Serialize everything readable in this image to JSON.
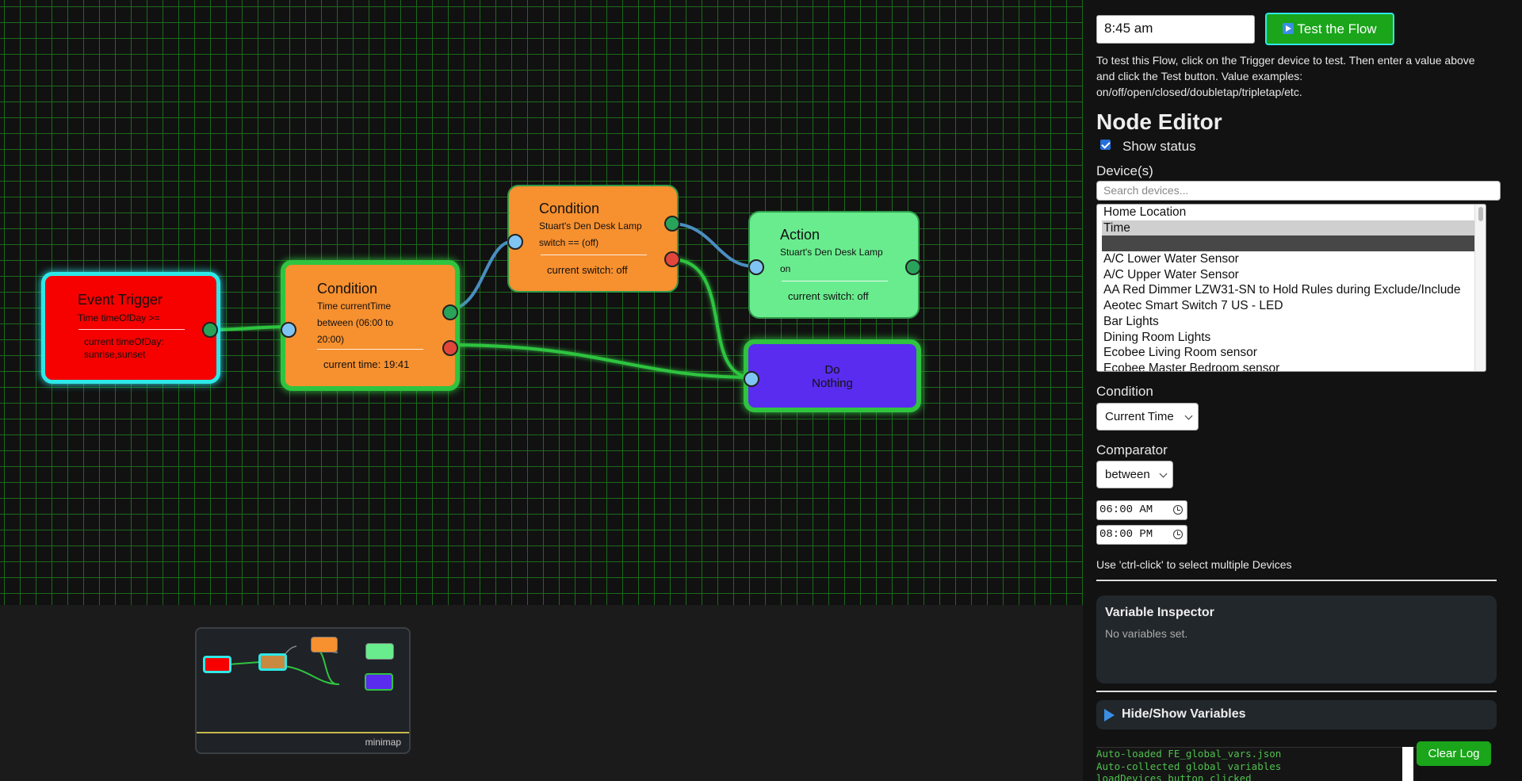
{
  "nodes": {
    "trigger": {
      "title": "Event Trigger",
      "subtitle": "Time timeOfDay >=",
      "status_1": "current timeOfDay:",
      "status_2": "sunrise,sunset"
    },
    "condition1": {
      "title": "Condition",
      "sub_1": "Time currentTime",
      "sub_2": "between (06:00 to",
      "sub_3": "20:00)",
      "status": "current time: 19:41"
    },
    "condition2": {
      "title": "Condition",
      "sub_1": "Stuart's Den Desk Lamp",
      "sub_2": "switch == (off)",
      "status": "current switch: off"
    },
    "action": {
      "title": "Action",
      "sub_1": "Stuart's Den Desk Lamp",
      "sub_2": "on",
      "status": "current switch: off"
    },
    "nothing": {
      "line_1": "Do",
      "line_2": "Nothing"
    }
  },
  "minimap": {
    "label": "minimap"
  },
  "panel": {
    "test_value": "8:45 am",
    "test_button": "Test the Flow",
    "help_text": "To test this Flow, click on the Trigger device to test. Then enter a value above and click the Test button. Value examples: on/off/open/closed/doubletap/tripletap/etc.",
    "editor_title": "Node Editor",
    "show_status_label": "Show status",
    "show_status_checked": true,
    "devices_label": "Device(s)",
    "device_search_placeholder": "Search devices...",
    "devices": [
      "Home Location",
      "Time",
      "",
      "A/C Lower Water Sensor",
      "A/C Upper Water Sensor",
      "AA Red Dimmer LZW31-SN to Hold Rules during Exclude/Include",
      "Aeotec Smart Switch 7 US - LED",
      "Bar Lights",
      "Dining Room Lights",
      "Ecobee Living Room sensor",
      "Ecobee Master Bedroom sensor"
    ],
    "condition_label": "Condition",
    "condition_value": "Current Time",
    "comparator_label": "Comparator",
    "comparator_value": "between",
    "time_from": "06:00 AM",
    "time_to": "08:00 PM",
    "ctrl_hint": "Use 'ctrl-click' to select multiple Devices",
    "variable_inspector_title": "Variable Inspector",
    "variable_inspector_empty": "No variables set.",
    "hide_show_label": "Hide/Show Variables",
    "log_lines": [
      "Auto-loaded FE_global_vars.json",
      "Auto-collected global variables",
      "loadDevices button clicked"
    ],
    "clear_log": "Clear Log"
  },
  "colors": {
    "grid": "#1c6a1c",
    "trigger": "#f60000",
    "condition": "#f7902f",
    "action": "#69ec8e",
    "nothing": "#5a2cf0",
    "selected_border": "#2ee8e8",
    "active_border": "#2fc43f",
    "true_port": "#2aa35a",
    "false_port": "#e2463b",
    "input_port": "#7fc4f2",
    "button_green": "#1aa51a"
  }
}
